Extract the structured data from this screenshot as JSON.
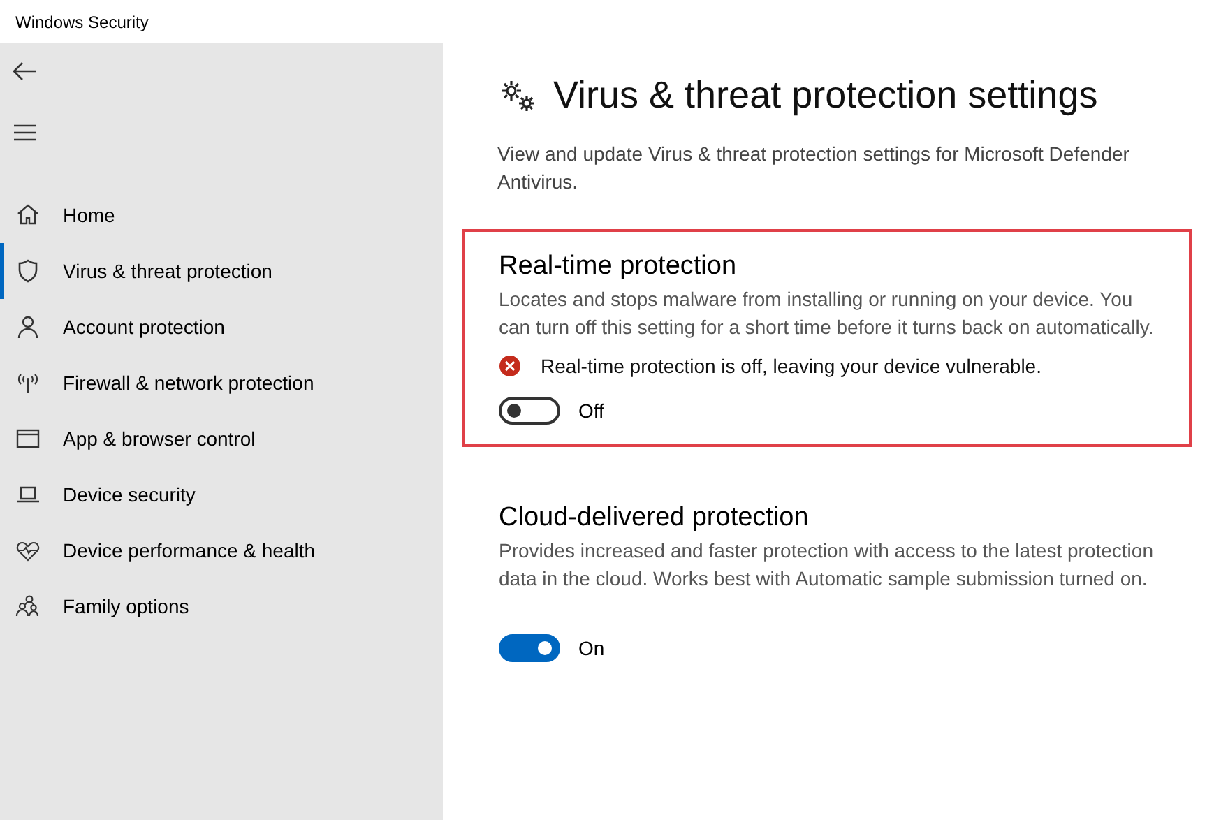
{
  "window": {
    "title": "Windows Security"
  },
  "sidebar": {
    "items": [
      {
        "label": "Home",
        "selected": false
      },
      {
        "label": "Virus & threat protection",
        "selected": true
      },
      {
        "label": "Account protection",
        "selected": false
      },
      {
        "label": "Firewall & network protection",
        "selected": false
      },
      {
        "label": "App & browser control",
        "selected": false
      },
      {
        "label": "Device security",
        "selected": false
      },
      {
        "label": "Device performance & health",
        "selected": false
      },
      {
        "label": "Family options",
        "selected": false
      }
    ]
  },
  "page": {
    "title": "Virus & threat protection settings",
    "description": "View and update Virus & threat protection settings for Microsoft Defender Antivirus."
  },
  "sections": [
    {
      "title": "Real-time protection",
      "highlighted": true,
      "description": "Locates and stops malware from installing or running on your device. You can turn off this setting for a short time before it turns back on automatically.",
      "alert": "Real-time protection is off, leaving your device vulnerable.",
      "on": false,
      "state_label": "Off"
    },
    {
      "title": "Cloud-delivered protection",
      "highlighted": false,
      "description": "Provides increased and faster protection with access to the latest protection data in the cloud. Works best with Automatic sample submission turned on.",
      "on": true,
      "state_label": "On"
    }
  ]
}
